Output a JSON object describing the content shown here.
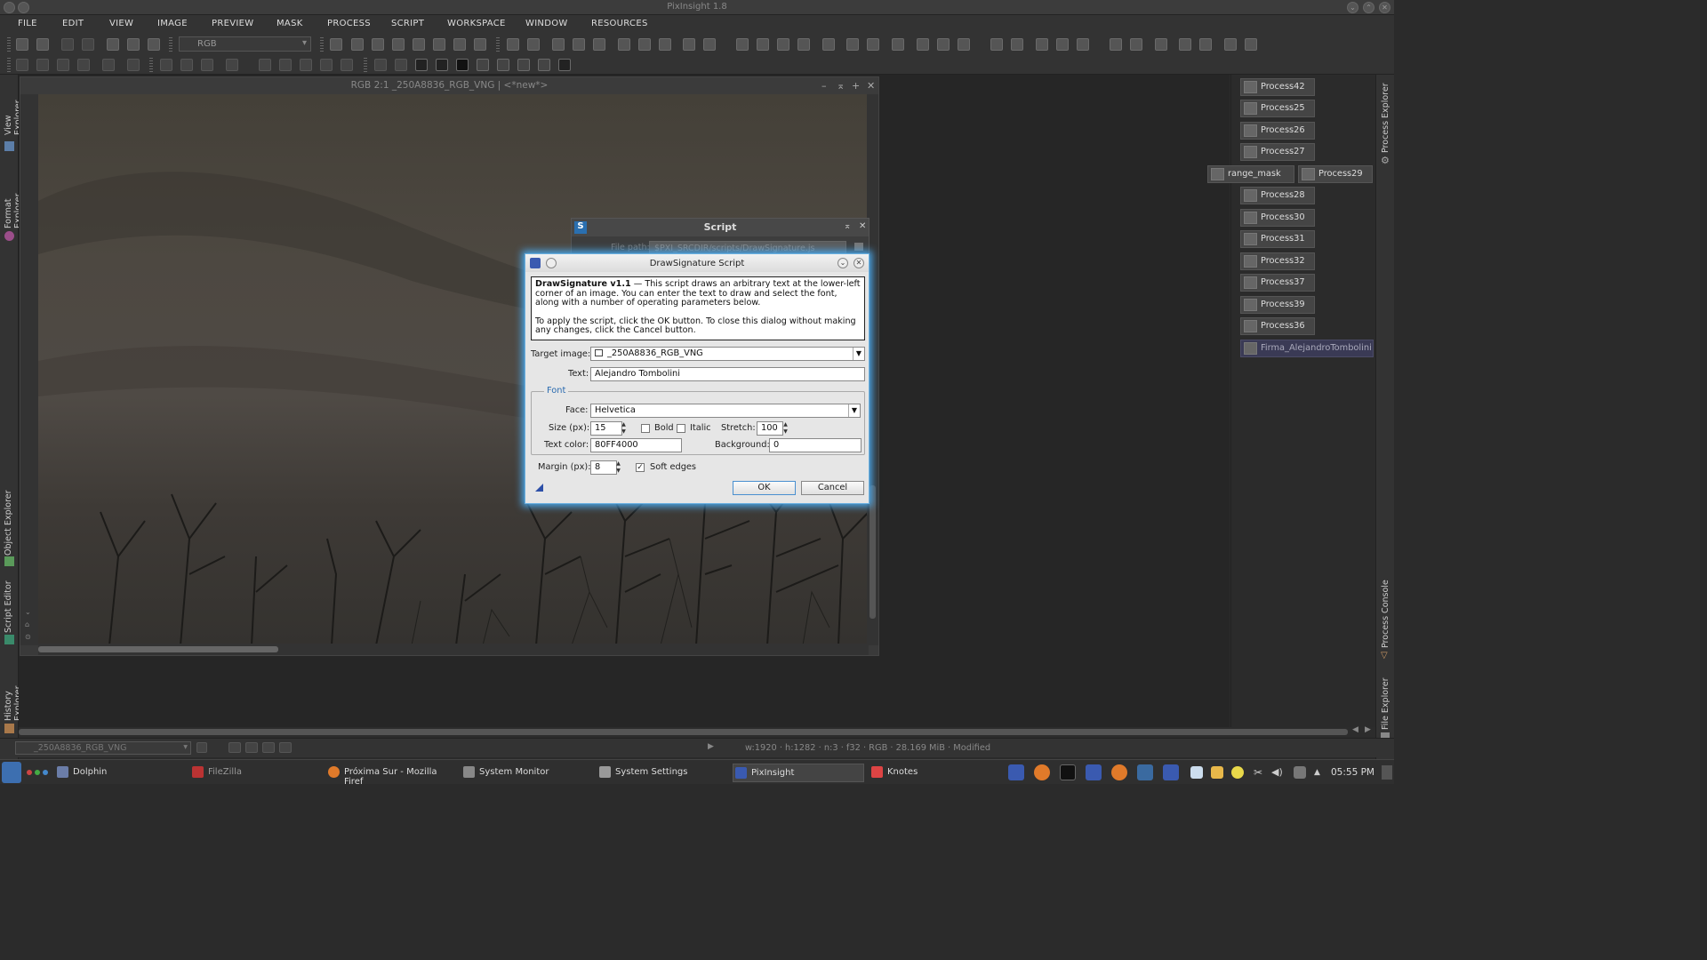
{
  "app": {
    "title": "PixInsight 1.8"
  },
  "menu": [
    "FILE",
    "EDIT",
    "VIEW",
    "IMAGE",
    "PREVIEW",
    "MASK",
    "PROCESS",
    "SCRIPT",
    "WORKSPACE",
    "WINDOW",
    "RESOURCES"
  ],
  "toolbar": {
    "color_space": "RGB"
  },
  "left_panels": {
    "view_explorer": "View Explorer",
    "image_id": "_250A8836_RGB_VNG",
    "format_explorer": "Format Explorer",
    "object_explorer": "Object Explorer",
    "script_editor": "Script Editor",
    "history_explorer": "History Explorer"
  },
  "image_window": {
    "title": "RGB 2:1 _250A8836_RGB_VNG | <*new*>"
  },
  "script_window": {
    "title": "Script",
    "file_path_label": "File path:",
    "file_path": "$PXI_SRCDIR/scripts/DrawSignature.js"
  },
  "dialog": {
    "title": "DrawSignature Script",
    "info_bold": "DrawSignature v1.1",
    "info_text": " — This script draws an arbitrary text at the lower-left corner of an image. You can enter the text to draw and select the font, along with a number of operating parameters below.",
    "info_text2": "To apply the script, click the OK button. To close this dialog without making any changes, click the Cancel button.",
    "target_label": "Target image:",
    "target_value": "_250A8836_RGB_VNG",
    "text_label": "Text:",
    "text_value": "Alejandro Tombolini",
    "font_group": "Font",
    "face_label": "Face:",
    "face_value": "Helvetica",
    "size_label": "Size (px):",
    "size_value": "15",
    "bold_label": "Bold",
    "italic_label": "Italic",
    "stretch_label": "Stretch:",
    "stretch_value": "100",
    "textcolor_label": "Text color:",
    "textcolor_value": "80FF4000",
    "background_label": "Background:",
    "background_value": "0",
    "margin_label": "Margin (px):",
    "margin_value": "8",
    "soft_edges_label": "Soft edges",
    "ok_label": "OK",
    "cancel_label": "Cancel"
  },
  "process_icons": [
    "Process42",
    "Process25",
    "Process26",
    "Process27",
    "range_mask",
    "Process29",
    "Process28",
    "Process30",
    "Process31",
    "Process32",
    "Process37",
    "Process39",
    "Process36",
    "Firma_AlejandroTombolini"
  ],
  "right_panels": {
    "process_explorer": "Process Explorer",
    "process_console": "Process Console",
    "file_explorer": "File Explorer"
  },
  "statusbar": {
    "view": "_250A8836_RGB_VNG",
    "info": "w:1920  ·  h:1282  ·  n:3  ·  f32  ·  RGB  ·  28.169 MiB  ·  Modified"
  },
  "taskbar": {
    "tasks": [
      "Dolphin",
      "FileZilla",
      "Próxima Sur - Mozilla Firef",
      "System Monitor",
      "System Settings",
      "PixInsight",
      "Knotes"
    ],
    "clock": "05:55 PM"
  }
}
